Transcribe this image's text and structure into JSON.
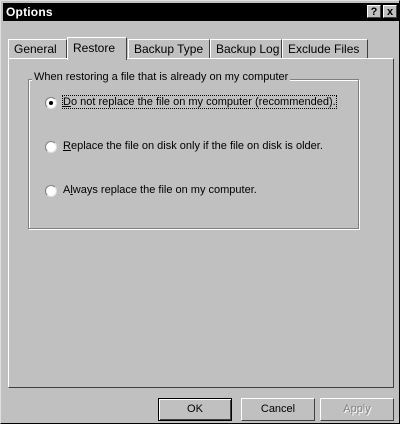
{
  "window": {
    "title": "Options",
    "help_label": "?",
    "close_label": "x"
  },
  "tabs": [
    {
      "label": "General",
      "active": false
    },
    {
      "label": "Restore",
      "active": true
    },
    {
      "label": "Backup Type",
      "active": false
    },
    {
      "label": "Backup Log",
      "active": false
    },
    {
      "label": "Exclude Files",
      "active": false
    }
  ],
  "restore": {
    "group_label": "When restoring a file that is already on my computer",
    "options": [
      {
        "accel": "D",
        "rest": "o not replace the file on my computer (recommended).",
        "checked": true
      },
      {
        "accel": "R",
        "rest": "eplace the file on disk only if the file on disk is older.",
        "checked": false
      },
      {
        "pre": "A",
        "accel": "l",
        "rest": "ways replace the file on my computer.",
        "checked": false
      }
    ]
  },
  "buttons": {
    "ok": "OK",
    "cancel": "Cancel",
    "apply": "Apply"
  },
  "colors": {
    "face": "#c0c0c0",
    "titlebar": "#000000",
    "disabled_text": "#808080"
  }
}
